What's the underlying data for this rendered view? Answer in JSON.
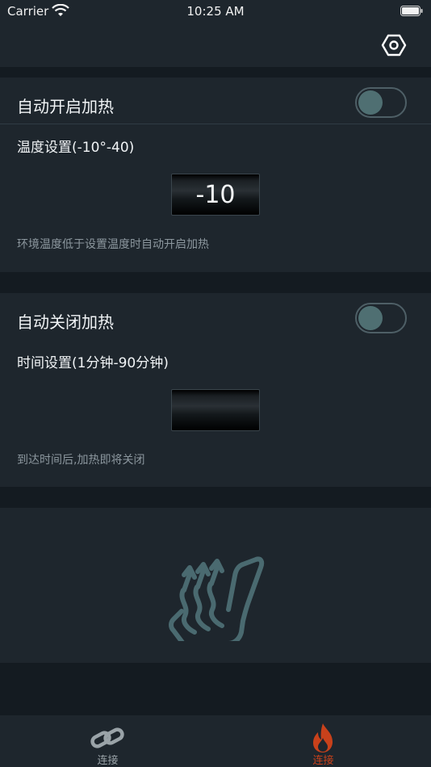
{
  "status_bar": {
    "carrier": "Carrier",
    "time": "10:25 AM"
  },
  "auto_on": {
    "title": "自动开启加热",
    "setting_label": "温度设置(-10°-40)",
    "value": "-10",
    "hint": "环境温度低于设置温度时自动开启加热",
    "toggle_on": false
  },
  "auto_off": {
    "title": "自动关闭加热",
    "setting_label": "时间设置(1分钟-90分钟)",
    "value": "",
    "hint": "到达时间后,加热即将关闭",
    "toggle_on": false
  },
  "tabs": [
    {
      "label": "连接",
      "icon": "link-icon",
      "color": "#9aa3a8",
      "selected": false
    },
    {
      "label": "连接",
      "icon": "flame-icon",
      "color": "#c8411b",
      "selected": true
    }
  ],
  "colors": {
    "accent": "#c8411b",
    "seat_icon": "#4a6a70",
    "background": "#1e262d"
  }
}
